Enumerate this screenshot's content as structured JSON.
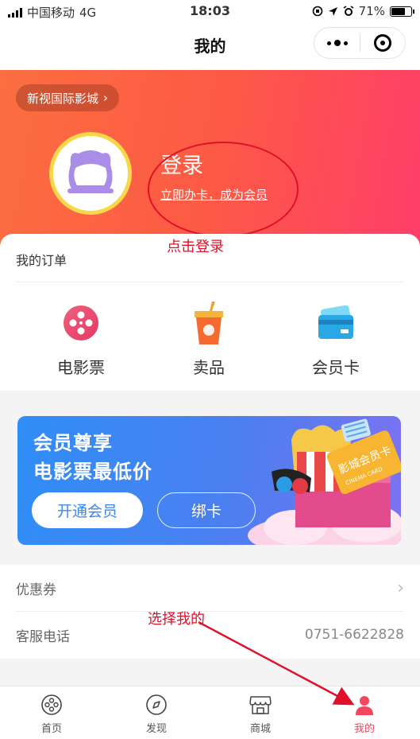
{
  "status_bar": {
    "carrier": "中国移动",
    "network": "4G",
    "time": "18:03",
    "battery": "71%",
    "battery_level": 0.71
  },
  "nav": {
    "title": "我的",
    "more_icon": "more-dots-icon",
    "close_icon": "target-circle-icon"
  },
  "profile": {
    "cinema_name": "新视国际影城",
    "login_title": "登录",
    "login_subtitle": "立即办卡，成为会员"
  },
  "orders": {
    "header": "我的订单",
    "items": [
      {
        "label": "电影票",
        "icon": "film-reel-icon"
      },
      {
        "label": "卖品",
        "icon": "drink-cup-icon"
      },
      {
        "label": "会员卡",
        "icon": "member-card-icon"
      }
    ]
  },
  "banner": {
    "line1": "会员尊享",
    "line2": "电影票最低价",
    "primary_button": "开通会员",
    "secondary_button": "绑卡",
    "card_text": "影城会员卡",
    "card_subtext": "CINEMA CARD"
  },
  "list": {
    "items": [
      {
        "label": "优惠券",
        "value": "",
        "chevron": "›"
      },
      {
        "label": "客服电话",
        "value": "0751-6622828"
      }
    ]
  },
  "annotations": {
    "login_hint": "点击登录",
    "tab_hint": "选择我的"
  },
  "tabbar": {
    "items": [
      {
        "label": "首页",
        "icon": "home-reel-icon"
      },
      {
        "label": "发现",
        "icon": "compass-icon"
      },
      {
        "label": "商城",
        "icon": "store-icon"
      },
      {
        "label": "我的",
        "icon": "user-icon",
        "active": true
      }
    ]
  },
  "colors": {
    "hero_start": "#fb6e40",
    "hero_end": "#fe3e6a",
    "active_tab": "#f2475f",
    "annotation_red": "#e0102a",
    "banner_blue": "#2f8ef7"
  }
}
